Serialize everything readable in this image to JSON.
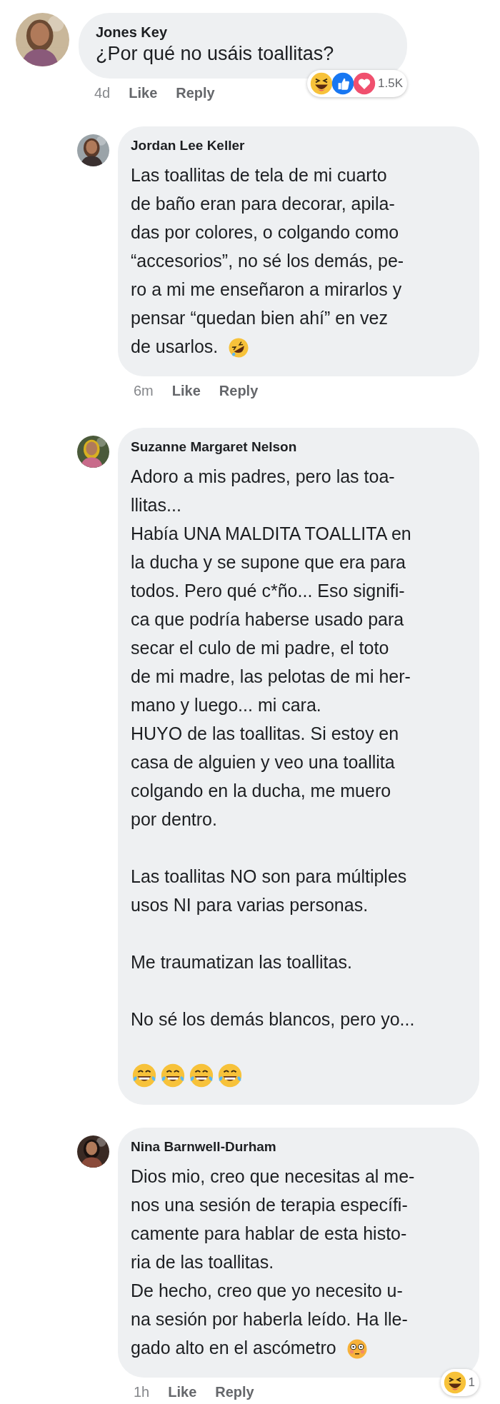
{
  "comments": [
    {
      "author": "Jones Key",
      "avatar": {
        "kind": "picture"
      },
      "paragraphs": [
        {
          "kind": "text",
          "lines": [
            "¿Por qué no usáis toallitas?"
          ]
        }
      ],
      "time": "4d",
      "actions": [
        "Like",
        "Reply"
      ],
      "reactions": {
        "icons": [
          {
            "kind": "haha"
          },
          {
            "kind": "like"
          },
          {
            "kind": "love"
          }
        ],
        "count": "1.5K"
      },
      "children": [
        {
          "author": "Jordan Lee Keller",
          "avatar": {
            "kind": "picture"
          },
          "paragraphs": [
            {
              "kind": "text",
              "lines": [
                "Las toallitas de tela de mi cuarto",
                "de baño eran para decorar, apila-",
                "das por colores, o colgando como",
                "“accesorios”, no sé los demás, pe-",
                "ro a mi me enseñaron a mirarlos y",
                "pensar “quedan bien ahí” en vez",
                "de usarlos."
              ],
              "end_icon": {
                "kind": "rofl"
              }
            }
          ],
          "time": "6m",
          "actions": [
            "Like",
            "Reply"
          ]
        },
        {
          "author": "Suzanne Margaret Nelson",
          "avatar": {
            "kind": "picture"
          },
          "paragraphs": [
            {
              "kind": "text",
              "lines": [
                "Adoro a mis padres, pero las toa-",
                "llitas...",
                "Había UNA MALDITA TOALLITA en",
                "la ducha y se supone que era para",
                "todos. Pero qué c*ño... Eso signifi-",
                "ca que podría haberse usado para",
                "secar el culo de mi padre, el toto",
                "de mi madre, las pelotas de mi her-",
                "mano y luego... mi cara.",
                "HUYO de las toallitas. Si estoy en",
                "casa de alguien y veo una toallita",
                "colgando en la ducha, me muero",
                "por dentro."
              ]
            },
            {
              "kind": "text",
              "lines": [
                "Las toallitas NO son para múltiples",
                "usos NI para varias personas."
              ]
            },
            {
              "kind": "text",
              "lines": [
                "Me traumatizan las toallitas."
              ]
            },
            {
              "kind": "text",
              "lines": [
                "No sé los demás blancos, pero yo..."
              ]
            },
            {
              "kind": "emoji_row",
              "icons": [
                {
                  "kind": "joy"
                },
                {
                  "kind": "joy"
                },
                {
                  "kind": "joy"
                },
                {
                  "kind": "joy"
                }
              ]
            }
          ]
        },
        {
          "author": "Nina Barnwell-Durham",
          "avatar": {
            "kind": "picture"
          },
          "paragraphs": [
            {
              "kind": "text",
              "lines": [
                "Dios mio, creo que necesitas al me-",
                "nos una sesión de terapia específi-",
                "camente para hablar de esta histo-",
                "ria de las toallitas.",
                "De hecho, creo que yo necesito u-",
                "na sesión por haberla leído. Ha lle-",
                "gado alto en el ascómetro"
              ],
              "end_icon": {
                "kind": "flushed"
              }
            }
          ],
          "time": "1h",
          "actions": [
            "Like",
            "Reply"
          ],
          "reactions": {
            "icons": [
              {
                "kind": "haha"
              }
            ],
            "count": "1"
          }
        }
      ]
    }
  ]
}
